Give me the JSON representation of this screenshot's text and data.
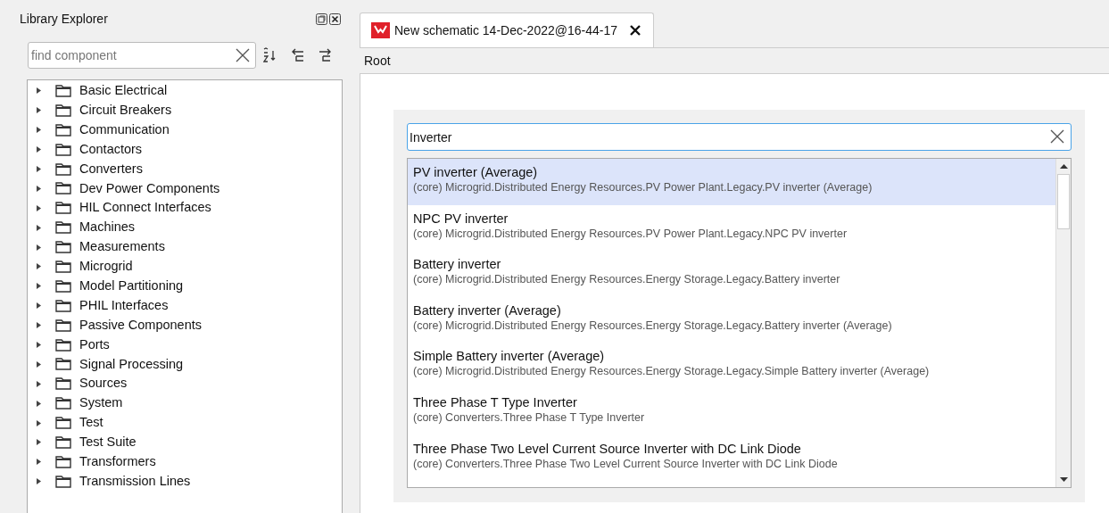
{
  "library_explorer": {
    "title": "Library Explorer",
    "search": {
      "placeholder": "find component"
    },
    "tree": [
      {
        "label": "Basic Electrical",
        "expanded": false
      },
      {
        "label": "Circuit Breakers",
        "expanded": false
      },
      {
        "label": "Communication",
        "expanded": false
      },
      {
        "label": "Contactors",
        "expanded": false
      },
      {
        "label": "Converters",
        "expanded": false
      },
      {
        "label": "Dev Power Components",
        "expanded": false
      },
      {
        "label": "HIL Connect Interfaces",
        "expanded": false
      },
      {
        "label": "Machines",
        "expanded": false
      },
      {
        "label": "Measurements",
        "expanded": false
      },
      {
        "label": "Microgrid",
        "expanded": false
      },
      {
        "label": "Model Partitioning",
        "expanded": false
      },
      {
        "label": "PHIL Interfaces",
        "expanded": false
      },
      {
        "label": "Passive Components",
        "expanded": false
      },
      {
        "label": "Ports",
        "expanded": false
      },
      {
        "label": "Signal Processing",
        "expanded": false
      },
      {
        "label": "Sources",
        "expanded": false
      },
      {
        "label": "System",
        "expanded": false
      },
      {
        "label": "Test",
        "expanded": false
      },
      {
        "label": "Test Suite",
        "expanded": false
      },
      {
        "label": "Transformers",
        "expanded": false
      },
      {
        "label": "Transmission Lines",
        "expanded": false
      }
    ]
  },
  "tabs": [
    {
      "label": "New schematic 14-Dec-2022@16-44-17",
      "selected": true
    }
  ],
  "breadcrumb": "Root",
  "quick_search": {
    "value": "Inverter",
    "results": [
      {
        "name": "PV inverter (Average)",
        "path": "(core) Microgrid.Distributed Energy Resources.PV Power Plant.Legacy.PV inverter (Average)",
        "selected": true
      },
      {
        "name": "NPC PV inverter",
        "path": "(core) Microgrid.Distributed Energy Resources.PV Power Plant.Legacy.NPC PV inverter",
        "selected": false
      },
      {
        "name": "Battery inverter",
        "path": "(core) Microgrid.Distributed Energy Resources.Energy Storage.Legacy.Battery inverter",
        "selected": false
      },
      {
        "name": "Battery inverter (Average)",
        "path": "(core) Microgrid.Distributed Energy Resources.Energy Storage.Legacy.Battery inverter (Average)",
        "selected": false
      },
      {
        "name": "Simple Battery inverter (Average)",
        "path": "(core) Microgrid.Distributed Energy Resources.Energy Storage.Legacy.Simple Battery inverter (Average)",
        "selected": false
      },
      {
        "name": "Three Phase T Type Inverter",
        "path": "(core) Converters.Three Phase T Type Inverter",
        "selected": false
      },
      {
        "name": "Three Phase Two Level Current Source Inverter with DC Link Diode",
        "path": "(core) Converters.Three Phase Two Level Current Source Inverter with DC Link Diode",
        "selected": false
      }
    ]
  }
}
